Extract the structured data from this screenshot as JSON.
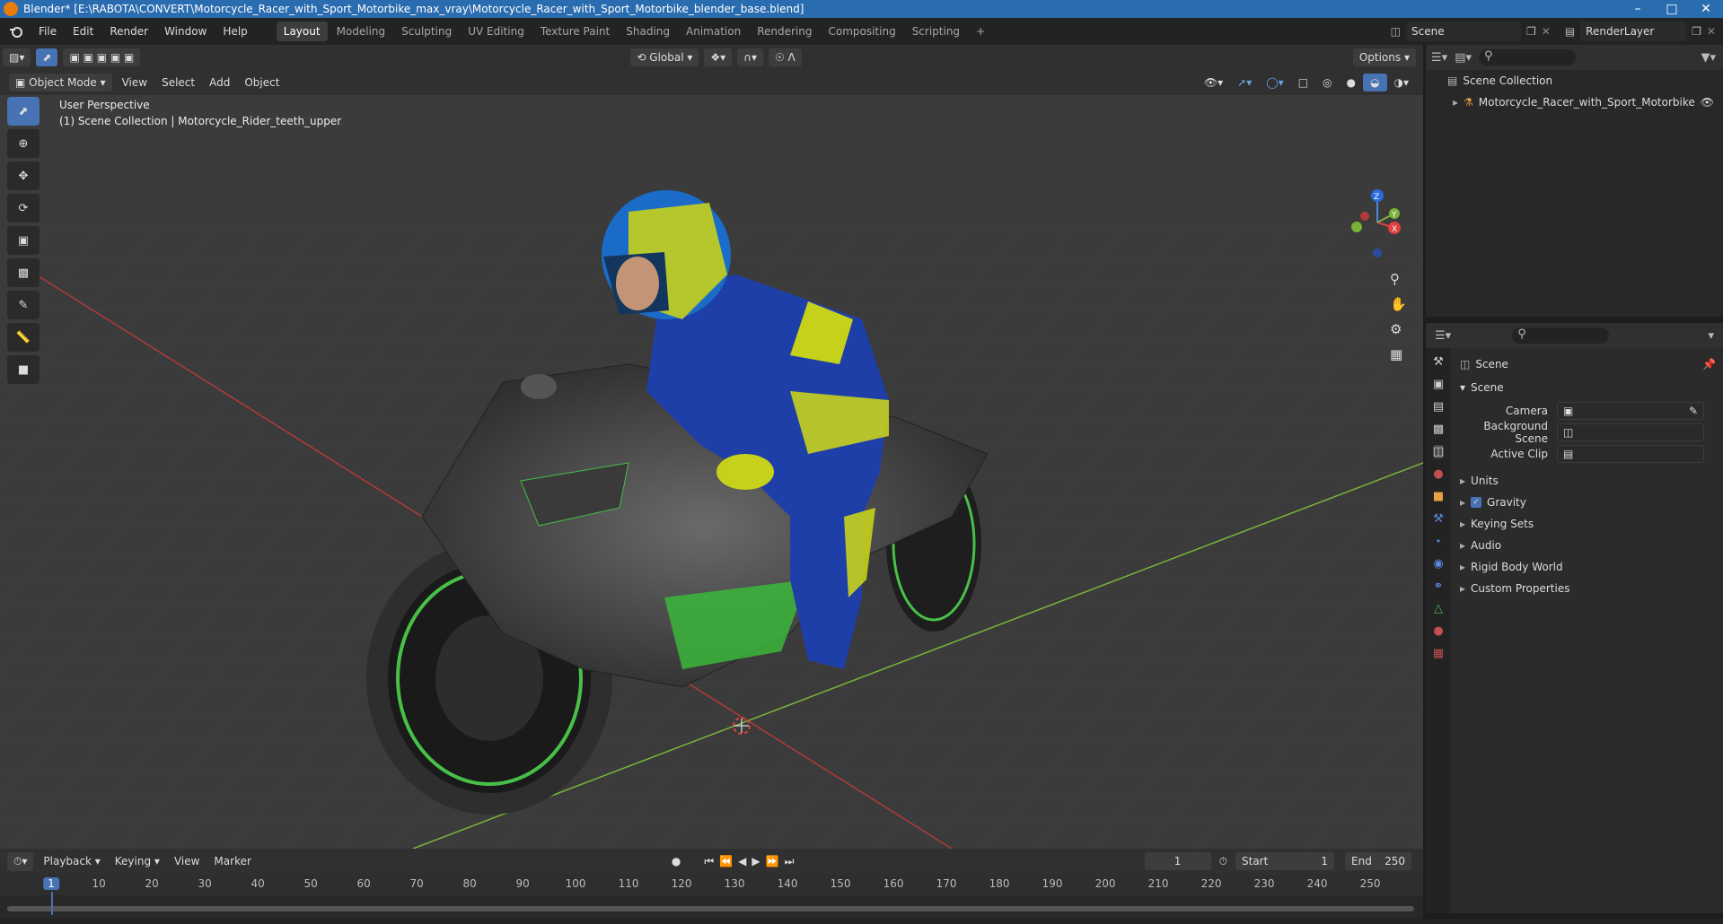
{
  "window": {
    "title": "Blender* [E:\\RABOTA\\CONVERT\\Motorcycle_Racer_with_Sport_Motorbike_max_vray\\Motorcycle_Racer_with_Sport_Motorbike_blender_base.blend]"
  },
  "menu": [
    "File",
    "Edit",
    "Render",
    "Window",
    "Help"
  ],
  "workspaces": [
    "Layout",
    "Modeling",
    "Sculpting",
    "UV Editing",
    "Texture Paint",
    "Shading",
    "Animation",
    "Rendering",
    "Compositing",
    "Scripting"
  ],
  "active_workspace": "Layout",
  "scene_name": "Scene",
  "render_layer": "RenderLayer",
  "viewport": {
    "transform_orientation": "Global",
    "options_label": "Options",
    "mode": "Object Mode",
    "header_menus": [
      "View",
      "Select",
      "Add",
      "Object"
    ],
    "perspective_label": "User Perspective",
    "collection_info": "(1) Scene Collection | Motorcycle_Rider_teeth_upper",
    "gizmo": {
      "x": "X",
      "y": "Y",
      "z": "Z"
    }
  },
  "outliner": {
    "root": "Scene Collection",
    "items": [
      "Motorcycle_Racer_with_Sport_Motorbike"
    ]
  },
  "properties": {
    "breadcrumb": "Scene",
    "panel_title": "Scene",
    "fields": [
      {
        "label": "Camera",
        "value": ""
      },
      {
        "label": "Background Scene",
        "value": ""
      },
      {
        "label": "Active Clip",
        "value": ""
      }
    ],
    "subpanels": [
      "Units",
      "Gravity",
      "Keying Sets",
      "Audio",
      "Rigid Body World",
      "Custom Properties"
    ],
    "gravity_checked": true
  },
  "timeline": {
    "menus": [
      "Playback",
      "Keying",
      "View",
      "Marker"
    ],
    "current_frame": "1",
    "start_label": "Start",
    "start_value": "1",
    "end_label": "End",
    "end_value": "250",
    "ticks": [
      "1",
      "10",
      "20",
      "30",
      "40",
      "50",
      "60",
      "70",
      "80",
      "90",
      "100",
      "110",
      "120",
      "130",
      "140",
      "150",
      "160",
      "170",
      "180",
      "190",
      "200",
      "210",
      "220",
      "230",
      "240",
      "250"
    ]
  },
  "colors": {
    "accent": "#4772b3",
    "title_bar": "#2a6cb0",
    "viewport_bg": "#3a3a3a",
    "x_axis": "#b33a3a",
    "y_axis": "#7ab33a"
  }
}
